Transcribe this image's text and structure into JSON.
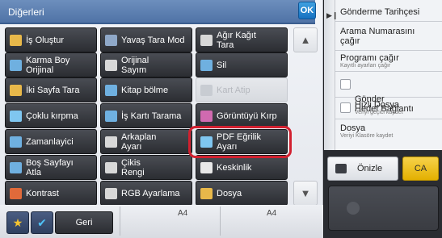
{
  "title": "Diğerleri",
  "ok_label": "OK",
  "buttons": [
    {
      "label": "İş Oluştur",
      "icon": "job-build-icon",
      "color": "#e8b84a",
      "enabled": true
    },
    {
      "label": "Yavaş Tara Mod",
      "icon": "slow-scan-icon",
      "color": "#8fa8c8",
      "enabled": true
    },
    {
      "label": "Ağır Kağıt\nTara",
      "icon": "heavy-paper-icon",
      "color": "#d8d8d8",
      "enabled": true
    },
    {
      "label": "Karma Boy\nOrijinal",
      "icon": "mixed-size-icon",
      "color": "#6fb0e0",
      "enabled": true
    },
    {
      "label": "Orijinal\nSayım",
      "icon": "original-count-icon",
      "color": "#d8d8d8",
      "enabled": true
    },
    {
      "label": "Sil",
      "icon": "erase-icon",
      "color": "#6fb0e0",
      "enabled": true
    },
    {
      "label": "İki Sayfa Tara",
      "icon": "two-page-icon",
      "color": "#e8b84a",
      "enabled": true
    },
    {
      "label": "Kitap bölme",
      "icon": "book-divide-icon",
      "color": "#6fb0e0",
      "enabled": true
    },
    {
      "label": "Kart Atip",
      "icon": "card-shot-icon",
      "color": "#c8ccd2",
      "enabled": false
    },
    {
      "label": "Çoklu kırpma",
      "icon": "multi-crop-icon",
      "color": "#7fc6f0",
      "enabled": true
    },
    {
      "label": "İş Kartı Tarama",
      "icon": "business-card-icon",
      "color": "#6fb0e0",
      "enabled": true
    },
    {
      "label": "Görüntüyü Kırp",
      "icon": "image-crop-icon",
      "color": "#d06ab0",
      "enabled": true
    },
    {
      "label": "Zamanlayici",
      "icon": "timer-icon",
      "color": "#6fb0e0",
      "enabled": true
    },
    {
      "label": "Arkaplan\nAyarı",
      "icon": "background-icon",
      "color": "#d8d8d8",
      "enabled": true
    },
    {
      "label": "PDF Eğrilik\nAyarı",
      "icon": "pdf-skew-icon",
      "color": "#7fc6f0",
      "enabled": true
    },
    {
      "label": "Boş Sayfayı\nAtla",
      "icon": "blank-page-icon",
      "color": "#6fb0e0",
      "enabled": true
    },
    {
      "label": "Çikis\nRengi",
      "icon": "output-color-icon",
      "color": "#d8d8d8",
      "enabled": true
    },
    {
      "label": "Keskinlik",
      "icon": "sharpness-icon",
      "color": "#e8e8e8",
      "enabled": true
    },
    {
      "label": "Kontrast",
      "icon": "contrast-icon",
      "color": "#e06a3a",
      "enabled": true
    },
    {
      "label": "RGB Ayarlama",
      "icon": "rgb-adjust-icon",
      "color": "#d8d8d8",
      "enabled": true
    },
    {
      "label": "Dosya",
      "icon": "folder-icon",
      "color": "#e8b84a",
      "enabled": true
    }
  ],
  "paper_sizes": [
    "A4",
    "A4"
  ],
  "back_label": "Geri",
  "right_panel": {
    "history": "Gönderme Tarihçesi",
    "call_number": "Arama Numarasını\nçağır",
    "call_program": "Programı çağır",
    "call_program_sub": "Kayıtlı ayarları çağır",
    "send_label": "Gönder\nHedef Bağlantı",
    "quick_file": "Hizli Dosya",
    "quick_file_sub": "Veriyi geçici kaydet",
    "file": "Dosya",
    "file_sub": "Veriyi Klasöre kaydet",
    "preview": "Önizle",
    "ca": "CA"
  }
}
